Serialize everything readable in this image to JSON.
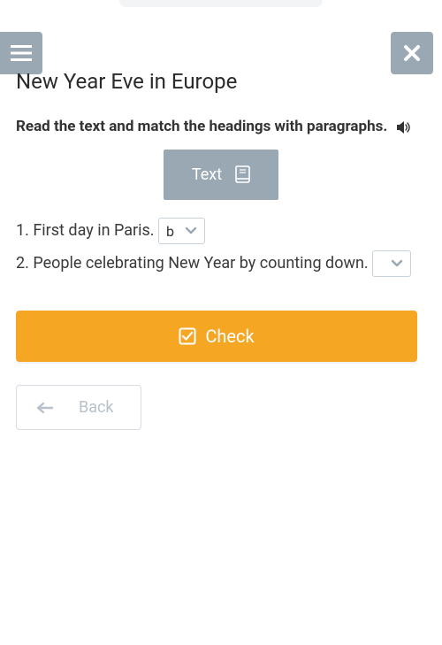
{
  "header": {
    "menu_icon": "menu-icon",
    "close_icon": "close-icon"
  },
  "page_title": "New Year Eve in Europe",
  "instruction": "Read the text and match the headings with paragraphs.",
  "text_button_label": "Text",
  "questions": [
    {
      "num": "1.",
      "text": "First day in Paris.",
      "selected": "b"
    },
    {
      "num": "2.",
      "text": "People celebrating New Year by counting down.",
      "selected": ""
    }
  ],
  "check_label": "Check",
  "back_label": "Back"
}
